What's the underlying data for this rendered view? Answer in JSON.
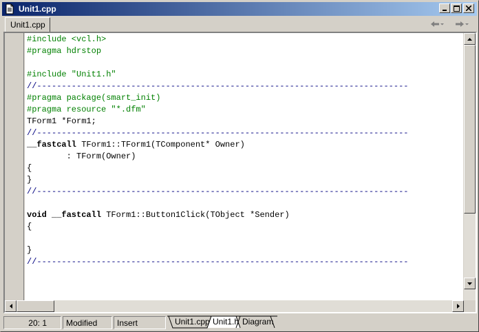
{
  "window": {
    "title": "Unit1.cpp"
  },
  "header": {
    "file_tab": "Unit1.cpp"
  },
  "editor": {
    "lines": [
      {
        "text": "#include <vcl.h>",
        "kind": "green"
      },
      {
        "text": "#pragma hdrstop",
        "kind": "green"
      },
      {
        "text": "",
        "kind": "plain"
      },
      {
        "text": "#include \"Unit1.h\"",
        "kind": "green"
      },
      {
        "text": "//---------------------------------------------------------------------------",
        "kind": "comment"
      },
      {
        "text": "#pragma package(smart_init)",
        "kind": "green"
      },
      {
        "text": "#pragma resource \"*.dfm\"",
        "kind": "green"
      },
      {
        "text": "TForm1 *Form1;",
        "kind": "plain"
      },
      {
        "text": "//---------------------------------------------------------------------------",
        "kind": "comment"
      },
      {
        "text": "__fastcall TForm1::TForm1(TComponent* Owner)",
        "kind": "plain",
        "bold": "__fastcall"
      },
      {
        "text": "        : TForm(Owner)",
        "kind": "plain"
      },
      {
        "text": "{",
        "kind": "plain"
      },
      {
        "text": "}",
        "kind": "plain"
      },
      {
        "text": "//---------------------------------------------------------------------------",
        "kind": "comment"
      },
      {
        "text": "",
        "kind": "plain"
      },
      {
        "text": "void __fastcall TForm1::Button1Click(TObject *Sender)",
        "kind": "plain",
        "bold": "void __fastcall"
      },
      {
        "text": "{",
        "kind": "plain"
      },
      {
        "text": "",
        "kind": "plain"
      },
      {
        "text": "}",
        "kind": "plain"
      },
      {
        "text": "//---------------------------------------------------------------------------",
        "kind": "comment"
      }
    ]
  },
  "status": {
    "position": "20:  1",
    "modified": "Modified",
    "mode": "Insert"
  },
  "bottom_tabs": [
    {
      "label": "Unit1.cpp"
    },
    {
      "label": "Unit1.h"
    },
    {
      "label": "Diagram"
    }
  ],
  "colors": {
    "titlebar_start": "#0a246a",
    "titlebar_end": "#a6caf0",
    "directive": "#008000",
    "comment": "#000080"
  }
}
